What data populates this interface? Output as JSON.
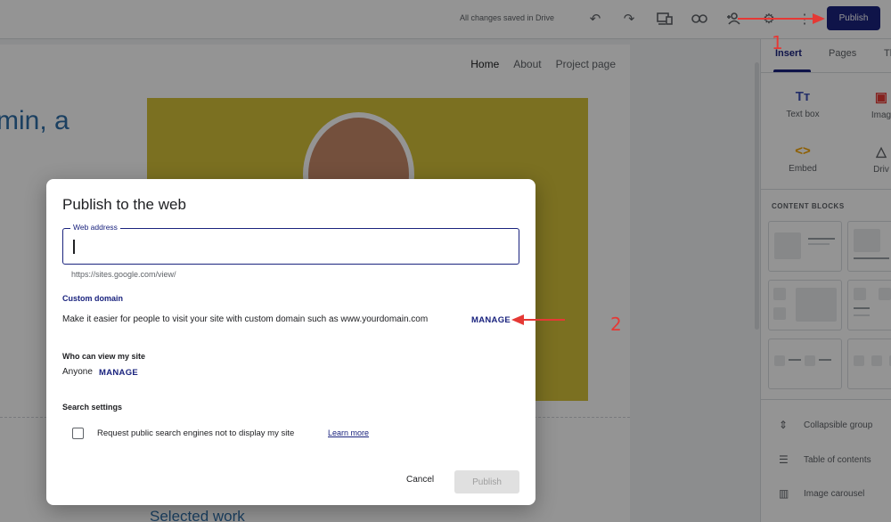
{
  "topbar": {
    "saved_status": "All changes saved in Drive",
    "icons": [
      "undo-icon",
      "redo-icon",
      "preview-icon",
      "link-icon",
      "share-icon",
      "settings-icon",
      "more-icon"
    ],
    "publish_label": "Publish"
  },
  "site": {
    "nav": [
      "Home",
      "About",
      "Project page"
    ],
    "hero_text": "min, a",
    "selected_work": "Selected work"
  },
  "panel": {
    "tabs": [
      "Insert",
      "Pages",
      "Th"
    ],
    "insert_items": [
      {
        "icon": "text-box-icon",
        "label": "Text box"
      },
      {
        "icon": "images-icon",
        "label": "Imag"
      },
      {
        "icon": "embed-icon",
        "label": "Embed"
      },
      {
        "icon": "drive-icon",
        "label": "Driv"
      }
    ],
    "content_blocks_label": "CONTENT BLOCKS",
    "bottom_items": [
      "Collapsible group",
      "Table of contents",
      "Image carousel"
    ]
  },
  "dialog": {
    "title": "Publish to the web",
    "web_address_label": "Web address",
    "web_address_value": "",
    "helper": "https://sites.google.com/view/",
    "custom_domain_label": "Custom domain",
    "custom_domain_text": "Make it easier for people to visit your site with custom domain such as www.yourdomain.com",
    "custom_domain_manage": "MANAGE",
    "who_label": "Who can view my site",
    "who_value": "Anyone",
    "who_manage": "MANAGE",
    "search_label": "Search settings",
    "search_checkbox": "Request public search engines not to display my site",
    "learn_more": "Learn more",
    "cancel": "Cancel",
    "publish": "Publish"
  },
  "annotations": {
    "n1": "1",
    "n2": "2",
    "color": "#e53935"
  },
  "colors": {
    "accent": "#1a237e",
    "hero_bg": "#d4c13a"
  }
}
